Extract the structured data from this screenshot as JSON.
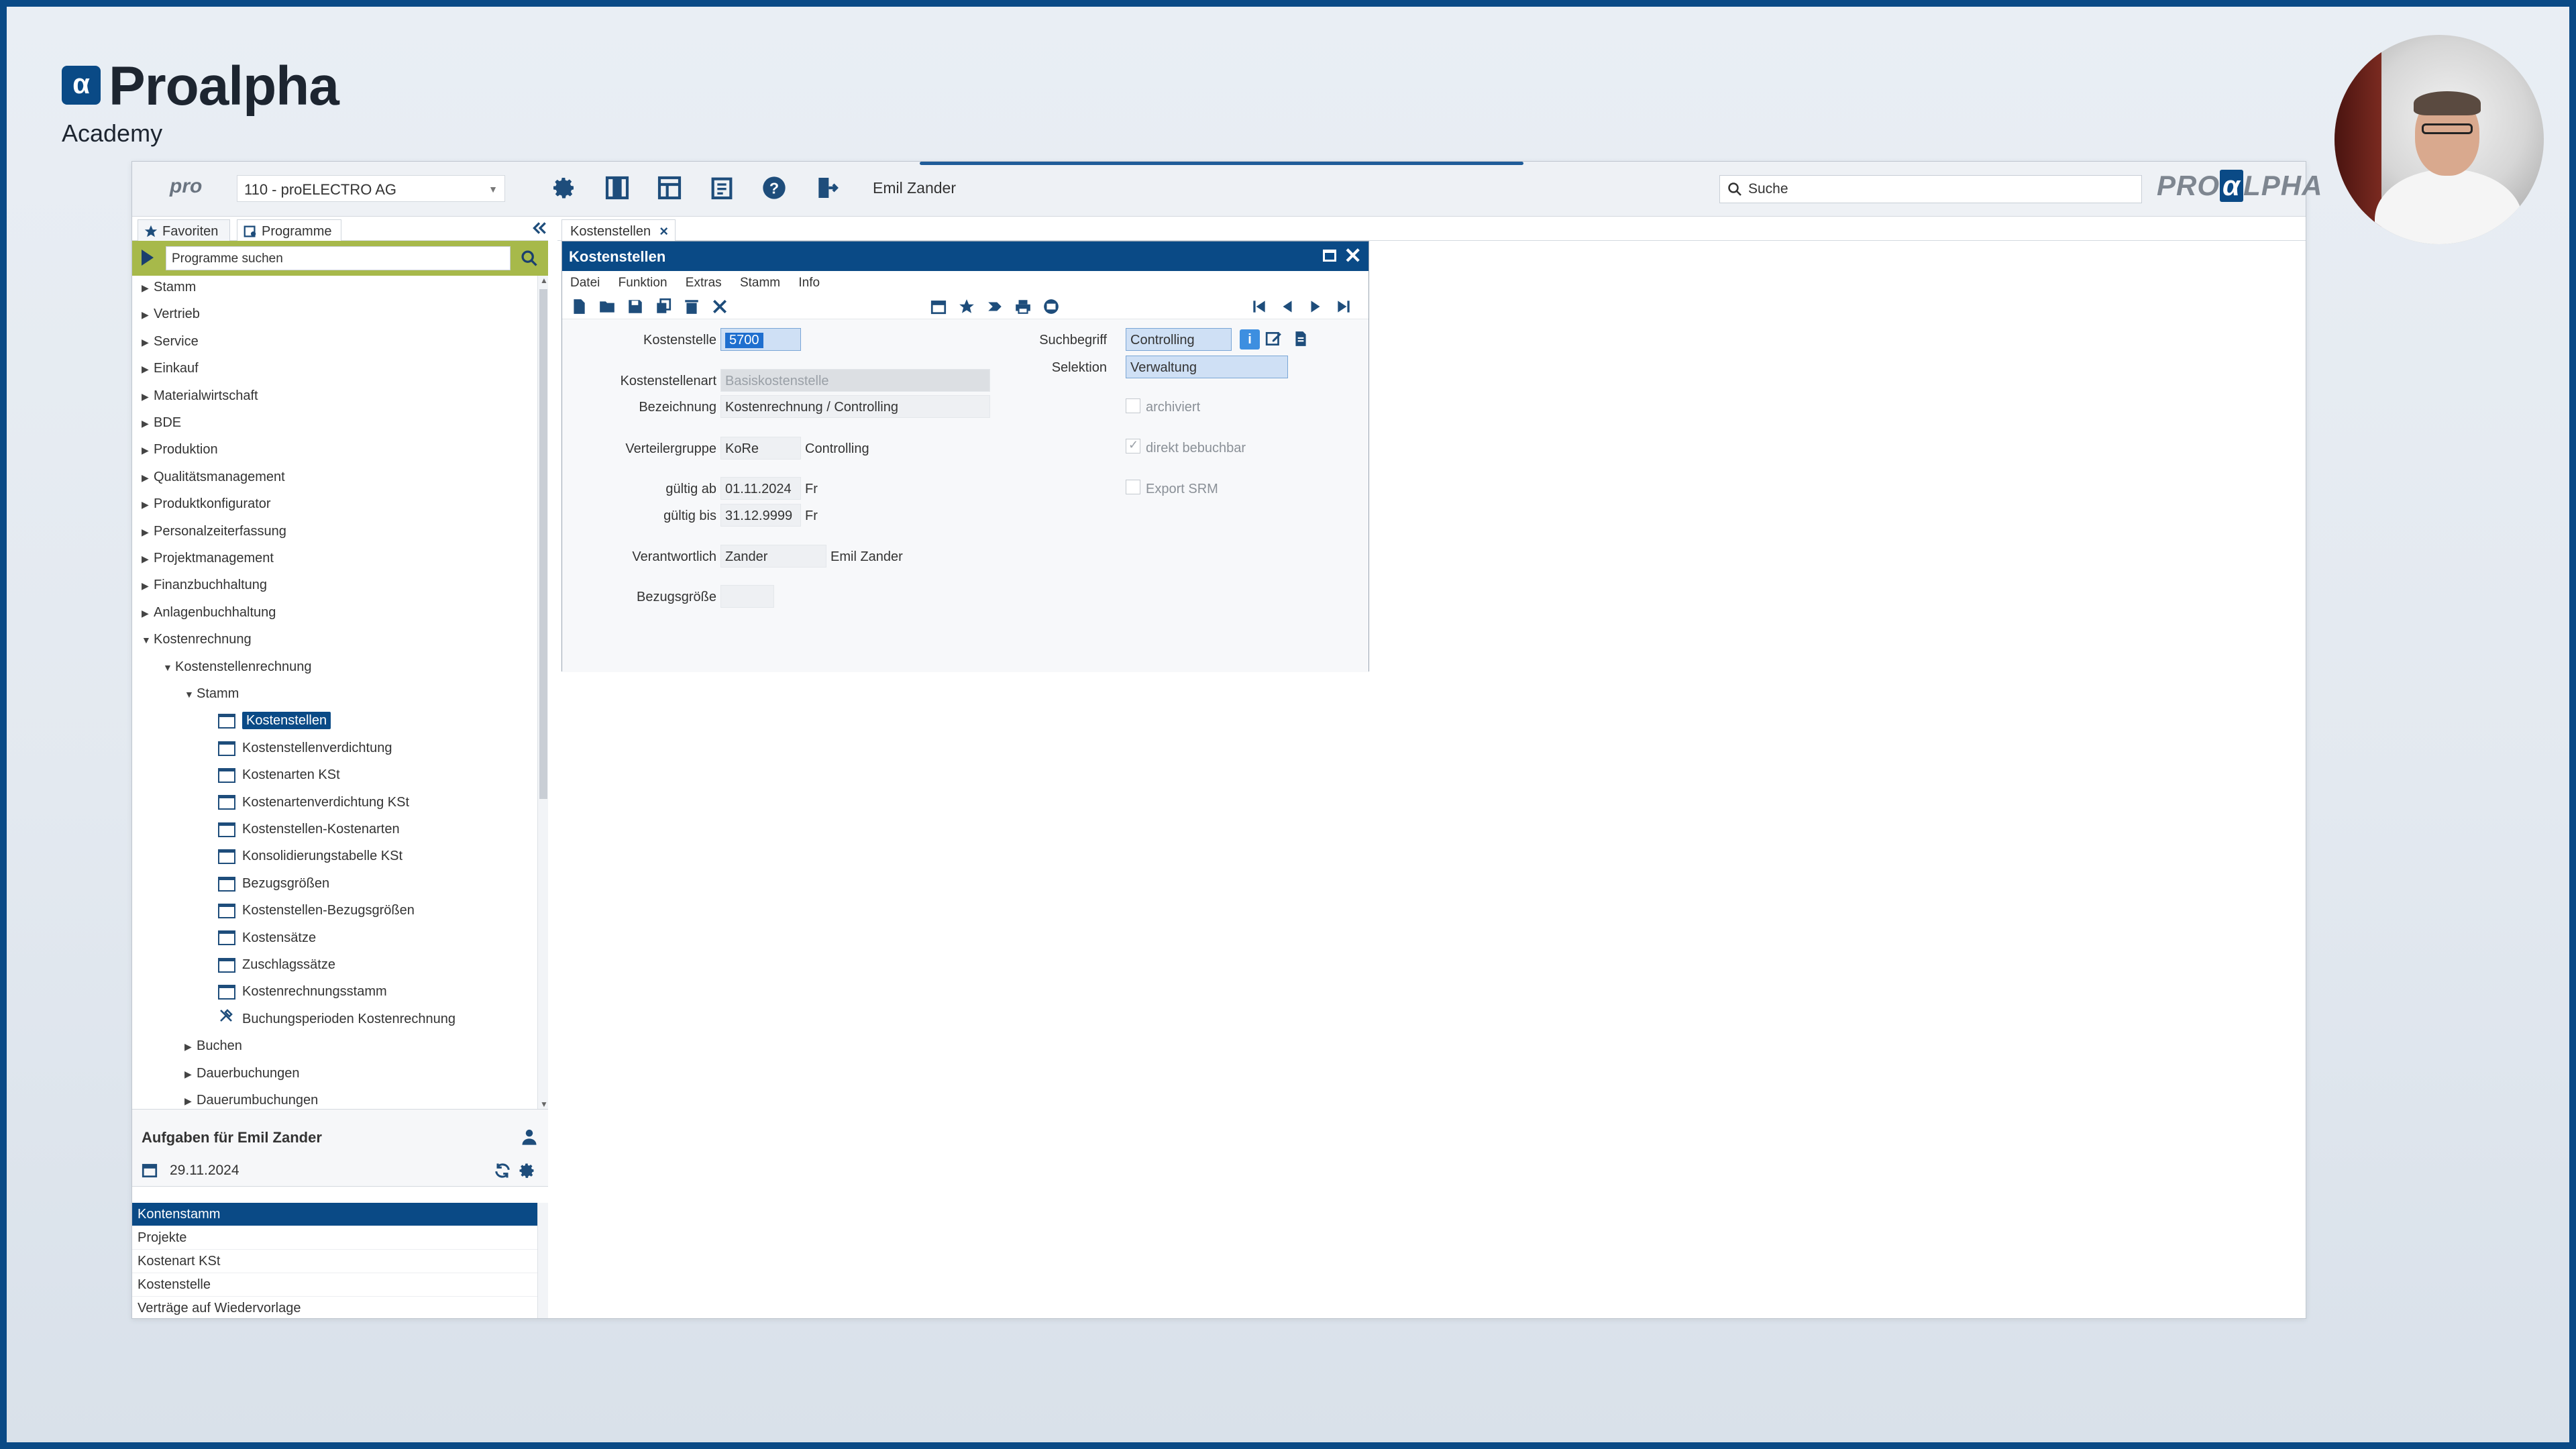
{
  "brand": {
    "name": "Proalpha",
    "sub": "Academy",
    "mark": "α"
  },
  "topbar": {
    "pro_logo": "pro",
    "company": "110 - proELECTRO AG",
    "user": "Emil Zander",
    "search_placeholder": "Suche",
    "logo_left": "PRO",
    "logo_alpha": "α",
    "logo_right": "LPHA"
  },
  "left_tabs": {
    "favorites": "Favoriten",
    "programs": "Programme"
  },
  "program_search": {
    "placeholder": "Programme suchen"
  },
  "tree": [
    {
      "label": "Stamm",
      "level": 0,
      "state": "collapsed"
    },
    {
      "label": "Vertrieb",
      "level": 0,
      "state": "collapsed"
    },
    {
      "label": "Service",
      "level": 0,
      "state": "collapsed"
    },
    {
      "label": "Einkauf",
      "level": 0,
      "state": "collapsed"
    },
    {
      "label": "Materialwirtschaft",
      "level": 0,
      "state": "collapsed"
    },
    {
      "label": "BDE",
      "level": 0,
      "state": "collapsed"
    },
    {
      "label": "Produktion",
      "level": 0,
      "state": "collapsed"
    },
    {
      "label": "Qualitätsmanagement",
      "level": 0,
      "state": "collapsed"
    },
    {
      "label": "Produktkonfigurator",
      "level": 0,
      "state": "collapsed"
    },
    {
      "label": "Personalzeiterfassung",
      "level": 0,
      "state": "collapsed"
    },
    {
      "label": "Projektmanagement",
      "level": 0,
      "state": "collapsed"
    },
    {
      "label": "Finanzbuchhaltung",
      "level": 0,
      "state": "collapsed"
    },
    {
      "label": "Anlagenbuchhaltung",
      "level": 0,
      "state": "collapsed"
    },
    {
      "label": "Kostenrechnung",
      "level": 0,
      "state": "expanded"
    },
    {
      "label": "Kostenstellenrechnung",
      "level": 1,
      "state": "expanded"
    },
    {
      "label": "Stamm",
      "level": 2,
      "state": "expanded"
    },
    {
      "label": "Kostenstellen",
      "level": 3,
      "state": "program",
      "selected": true
    },
    {
      "label": "Kostenstellenverdichtung",
      "level": 3,
      "state": "program"
    },
    {
      "label": "Kostenarten KSt",
      "level": 3,
      "state": "program"
    },
    {
      "label": "Kostenartenverdichtung KSt",
      "level": 3,
      "state": "program"
    },
    {
      "label": "Kostenstellen-Kostenarten",
      "level": 3,
      "state": "program"
    },
    {
      "label": "Konsolidierungstabelle KSt",
      "level": 3,
      "state": "program"
    },
    {
      "label": "Bezugsgrößen",
      "level": 3,
      "state": "program"
    },
    {
      "label": "Kostenstellen-Bezugsgrößen",
      "level": 3,
      "state": "program"
    },
    {
      "label": "Kostensätze",
      "level": 3,
      "state": "program"
    },
    {
      "label": "Zuschlagssätze",
      "level": 3,
      "state": "program"
    },
    {
      "label": "Kostenrechnungsstamm",
      "level": 3,
      "state": "program"
    },
    {
      "label": "Buchungsperioden Kostenrechnung",
      "level": 3,
      "state": "tool"
    },
    {
      "label": "Buchen",
      "level": 2,
      "state": "collapsed"
    },
    {
      "label": "Dauerbuchungen",
      "level": 2,
      "state": "collapsed"
    },
    {
      "label": "Dauerumbuchungen",
      "level": 2,
      "state": "collapsed"
    }
  ],
  "tasks": {
    "title": "Aufgaben für Emil Zander",
    "date": "29.11.2024",
    "items": [
      "Kontenstamm",
      "Projekte",
      "Kostenart KSt",
      "Kostenstelle",
      "Verträge auf Wiedervorlage"
    ]
  },
  "content_tab": {
    "label": "Kostenstellen"
  },
  "window": {
    "title": "Kostenstellen",
    "menu": [
      "Datei",
      "Funktion",
      "Extras",
      "Stamm",
      "Info"
    ]
  },
  "form": {
    "kostenstelle_label": "Kostenstelle",
    "kostenstelle_value": "5700",
    "suchbegriff_label": "Suchbegriff",
    "suchbegriff_value": "Controlling",
    "selektion_label": "Selektion",
    "selektion_value": "Verwaltung",
    "kostenstellenart_label": "Kostenstellenart",
    "kostenstellenart_value": "Basiskostenstelle",
    "bezeichnung_label": "Bezeichnung",
    "bezeichnung_value": "Kostenrechnung / Controlling",
    "archiviert_label": "archiviert",
    "direkt_label": "direkt bebuchbar",
    "direkt_checked": true,
    "verteilergruppe_label": "Verteilergruppe",
    "verteilergruppe_value": "KoRe",
    "verteilergruppe_desc": "Controlling",
    "gueltig_ab_label": "gültig ab",
    "gueltig_ab_value": "01.11.2024",
    "gueltig_ab_day": "Fr",
    "gueltig_bis_label": "gültig bis",
    "gueltig_bis_value": "31.12.9999",
    "gueltig_bis_day": "Fr",
    "export_label": "Export SRM",
    "verantwortlich_label": "Verantwortlich",
    "verantwortlich_value": "Zander",
    "verantwortlich_name": "Emil Zander",
    "bezugsgroesse_label": "Bezugsgröße",
    "bezugsgroesse_value": ""
  },
  "colors": {
    "accent": "#0a4a86",
    "search_bar": "#a7b94a",
    "frame": "#0a4a86"
  }
}
